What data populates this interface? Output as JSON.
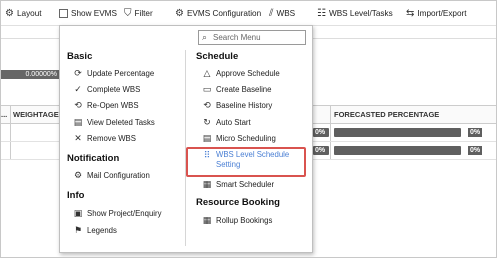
{
  "toolbar": {
    "items": [
      {
        "icon": "gear-icon",
        "glyph": "⚙",
        "label": "Layout"
      },
      {
        "icon": "checkbox",
        "glyph": "",
        "label": "Show EVMS"
      },
      {
        "icon": "filter-icon",
        "glyph": "⛉",
        "label": "Filter"
      },
      {
        "icon": "evms-config-icon",
        "glyph": "⚙",
        "label": "EVMS Configuration"
      },
      {
        "icon": "wbs-chart-icon",
        "glyph": "⫽",
        "label": "WBS"
      },
      {
        "icon": "wbs-level-icon",
        "glyph": "☷",
        "label": "WBS Level/Tasks"
      },
      {
        "icon": "import-export-icon",
        "glyph": "⇆",
        "label": "Import/Export"
      }
    ]
  },
  "background": {
    "left_progress_text": "0.00000%",
    "grid_headers": {
      "col1": "...",
      "col2": "WEIGHTAGE",
      "col3": "FORECASTED PERCENTAGE"
    },
    "row_progress": [
      "0%",
      "0%"
    ],
    "forecast_progress": [
      "0%",
      "0%"
    ]
  },
  "menu": {
    "search_placeholder": "Search Menu",
    "basic": {
      "title": "Basic",
      "items": [
        {
          "glyph": "⟳",
          "label": "Update Percentage"
        },
        {
          "glyph": "✓",
          "label": "Complete WBS"
        },
        {
          "glyph": "⟲",
          "label": "Re-Open WBS"
        },
        {
          "glyph": "▤",
          "label": "View Deleted Tasks"
        },
        {
          "glyph": "✕",
          "label": "Remove WBS"
        }
      ]
    },
    "notification": {
      "title": "Notification",
      "items": [
        {
          "glyph": "⚙",
          "label": "Mail Configuration"
        }
      ]
    },
    "info": {
      "title": "Info",
      "items": [
        {
          "glyph": "▣",
          "label": "Show Project/Enquiry"
        },
        {
          "glyph": "⚑",
          "label": "Legends"
        }
      ]
    },
    "schedule": {
      "title": "Schedule",
      "items": [
        {
          "glyph": "△",
          "label": "Approve Schedule"
        },
        {
          "glyph": "▭",
          "label": "Create Baseline"
        },
        {
          "glyph": "⟲",
          "label": "Baseline History"
        },
        {
          "glyph": "↻",
          "label": "Auto Start"
        },
        {
          "glyph": "▤",
          "label": "Micro Scheduling"
        },
        {
          "glyph": "⠿",
          "label": "WBS Level Schedule",
          "label2": "Setting"
        },
        {
          "glyph": "▦",
          "label": "Smart Scheduler"
        }
      ]
    },
    "resource_booking": {
      "title": "Resource Booking",
      "items": [
        {
          "glyph": "▦",
          "label": "Rollup Bookings"
        }
      ]
    }
  }
}
